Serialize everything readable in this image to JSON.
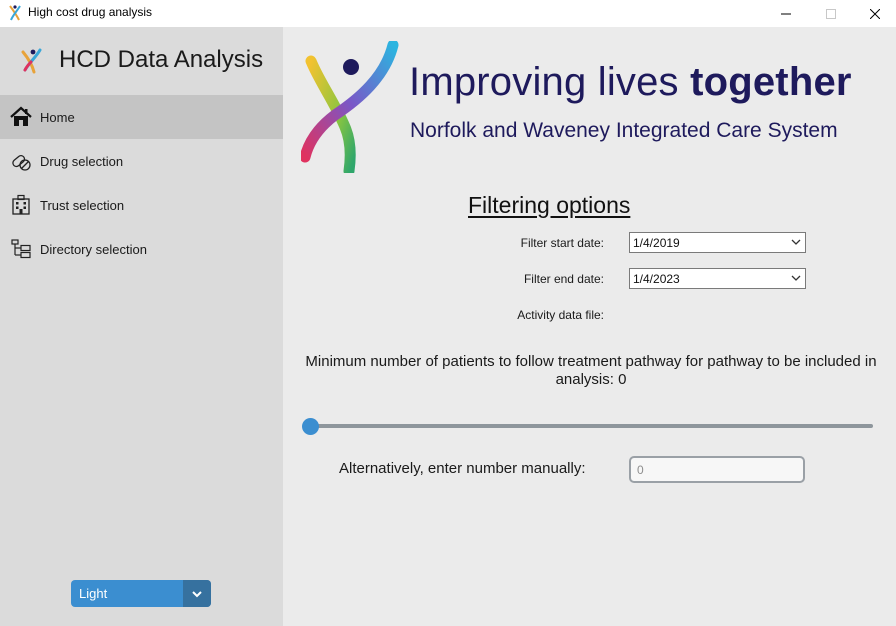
{
  "window": {
    "title": "High cost drug analysis",
    "controls": [
      "minimize",
      "maximize",
      "close"
    ]
  },
  "sidebar": {
    "brand": "HCD Data Analysis",
    "items": [
      {
        "label": "Home",
        "icon": "home-icon",
        "active": true
      },
      {
        "label": "Drug selection",
        "icon": "pills-icon",
        "active": false
      },
      {
        "label": "Trust selection",
        "icon": "hospital-icon",
        "active": false
      },
      {
        "label": "Directory selection",
        "icon": "folder-tree-icon",
        "active": false
      }
    ],
    "theme": {
      "value": "Light"
    }
  },
  "banner": {
    "slogan_regular": "Improving lives ",
    "slogan_bold": "together",
    "organisation": "Norfolk and Waveney Integrated Care System"
  },
  "filtering": {
    "title": "Filtering options",
    "start_label": "Filter start date:",
    "start_value": "1/4/2019",
    "end_label": "Filter end date:",
    "end_value": "1/4/2023",
    "activity_label": "Activity data file:",
    "min_patients_text": "Minimum number of patients to follow treatment pathway for pathway to be included in analysis: 0",
    "slider_value": 0,
    "manual_label": "Alternatively, enter number manually:",
    "manual_placeholder": "0"
  },
  "colors": {
    "accent": "#3b8ed0",
    "accent_dark": "#36719f",
    "sidebar_bg": "#dbdbdb",
    "active_item_bg": "#c4c4c4",
    "brand_navy": "#1e1a5c"
  }
}
